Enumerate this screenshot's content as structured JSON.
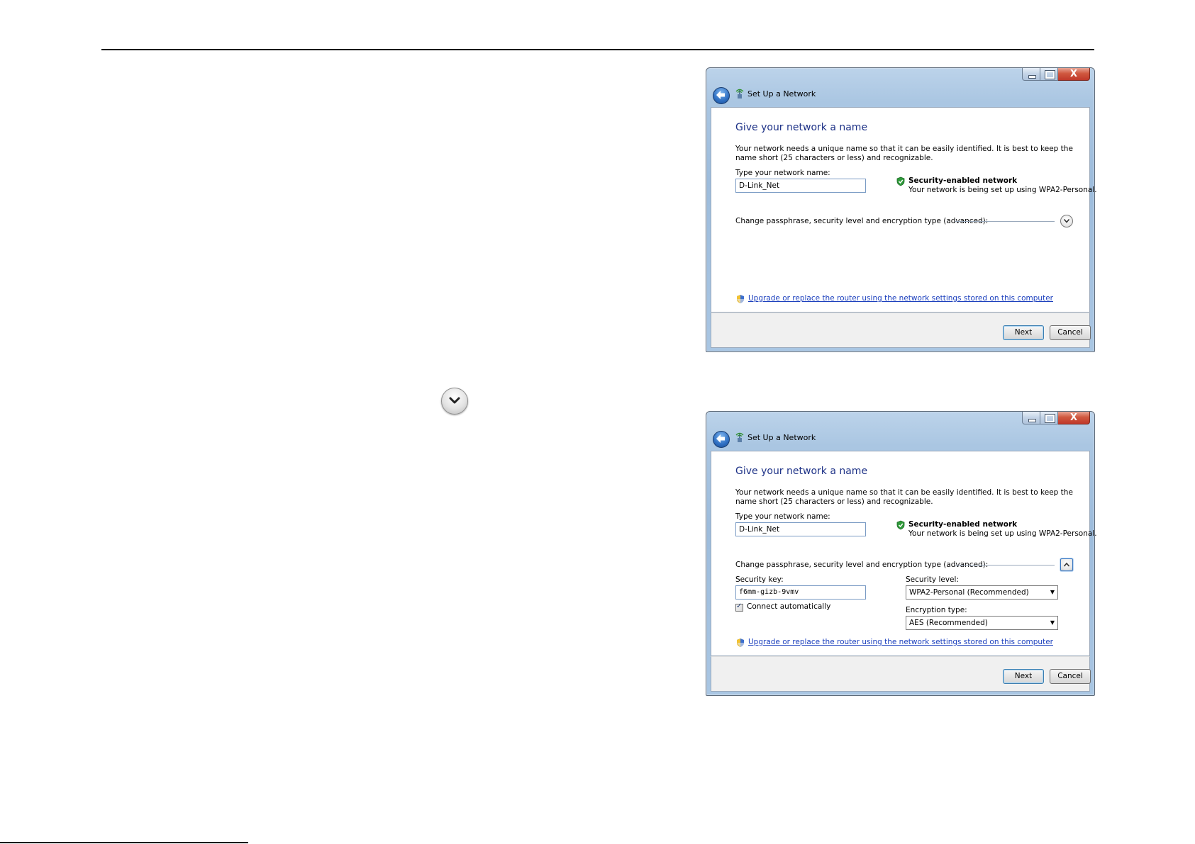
{
  "dialog": {
    "title": "Set Up a Network",
    "close_label": "X",
    "heading": "Give your network a name",
    "description": "Your network needs a unique name so that it can be easily identified. It is best to keep the name short (25 characters or less) and recognizable.",
    "network_name_label": "Type your network name:",
    "network_name_value": "D-Link_Net",
    "security_title": "Security-enabled network",
    "security_subtitle": "Your network is being set up using WPA2-Personal.",
    "advanced_label": "Change passphrase, security level and encryption type (advanced):",
    "upgrade_link": "Upgrade or replace the router using the network settings stored on this computer",
    "next_label": "Next",
    "cancel_label": "Cancel"
  },
  "advanced": {
    "security_key_label": "Security key:",
    "security_key_value": "f6mm-gizb-9vmv",
    "connect_auto_label": "Connect automatically",
    "connect_auto_checked": true,
    "security_level_label": "Security level:",
    "security_level_value": "WPA2-Personal (Recommended)",
    "encryption_type_label": "Encryption type:",
    "encryption_type_value": "AES (Recommended)"
  },
  "icons": {
    "expand": "chevron-down-icon",
    "collapse": "chevron-up-icon",
    "back": "back-arrow-icon",
    "network": "network-icon",
    "shield": "shield-check-icon",
    "uac": "uac-shield-icon",
    "dropdown": "dropdown-arrow-icon"
  },
  "colors": {
    "heading": "#1e3287",
    "link": "#1b3fbd",
    "close_button": "#c0382a"
  }
}
